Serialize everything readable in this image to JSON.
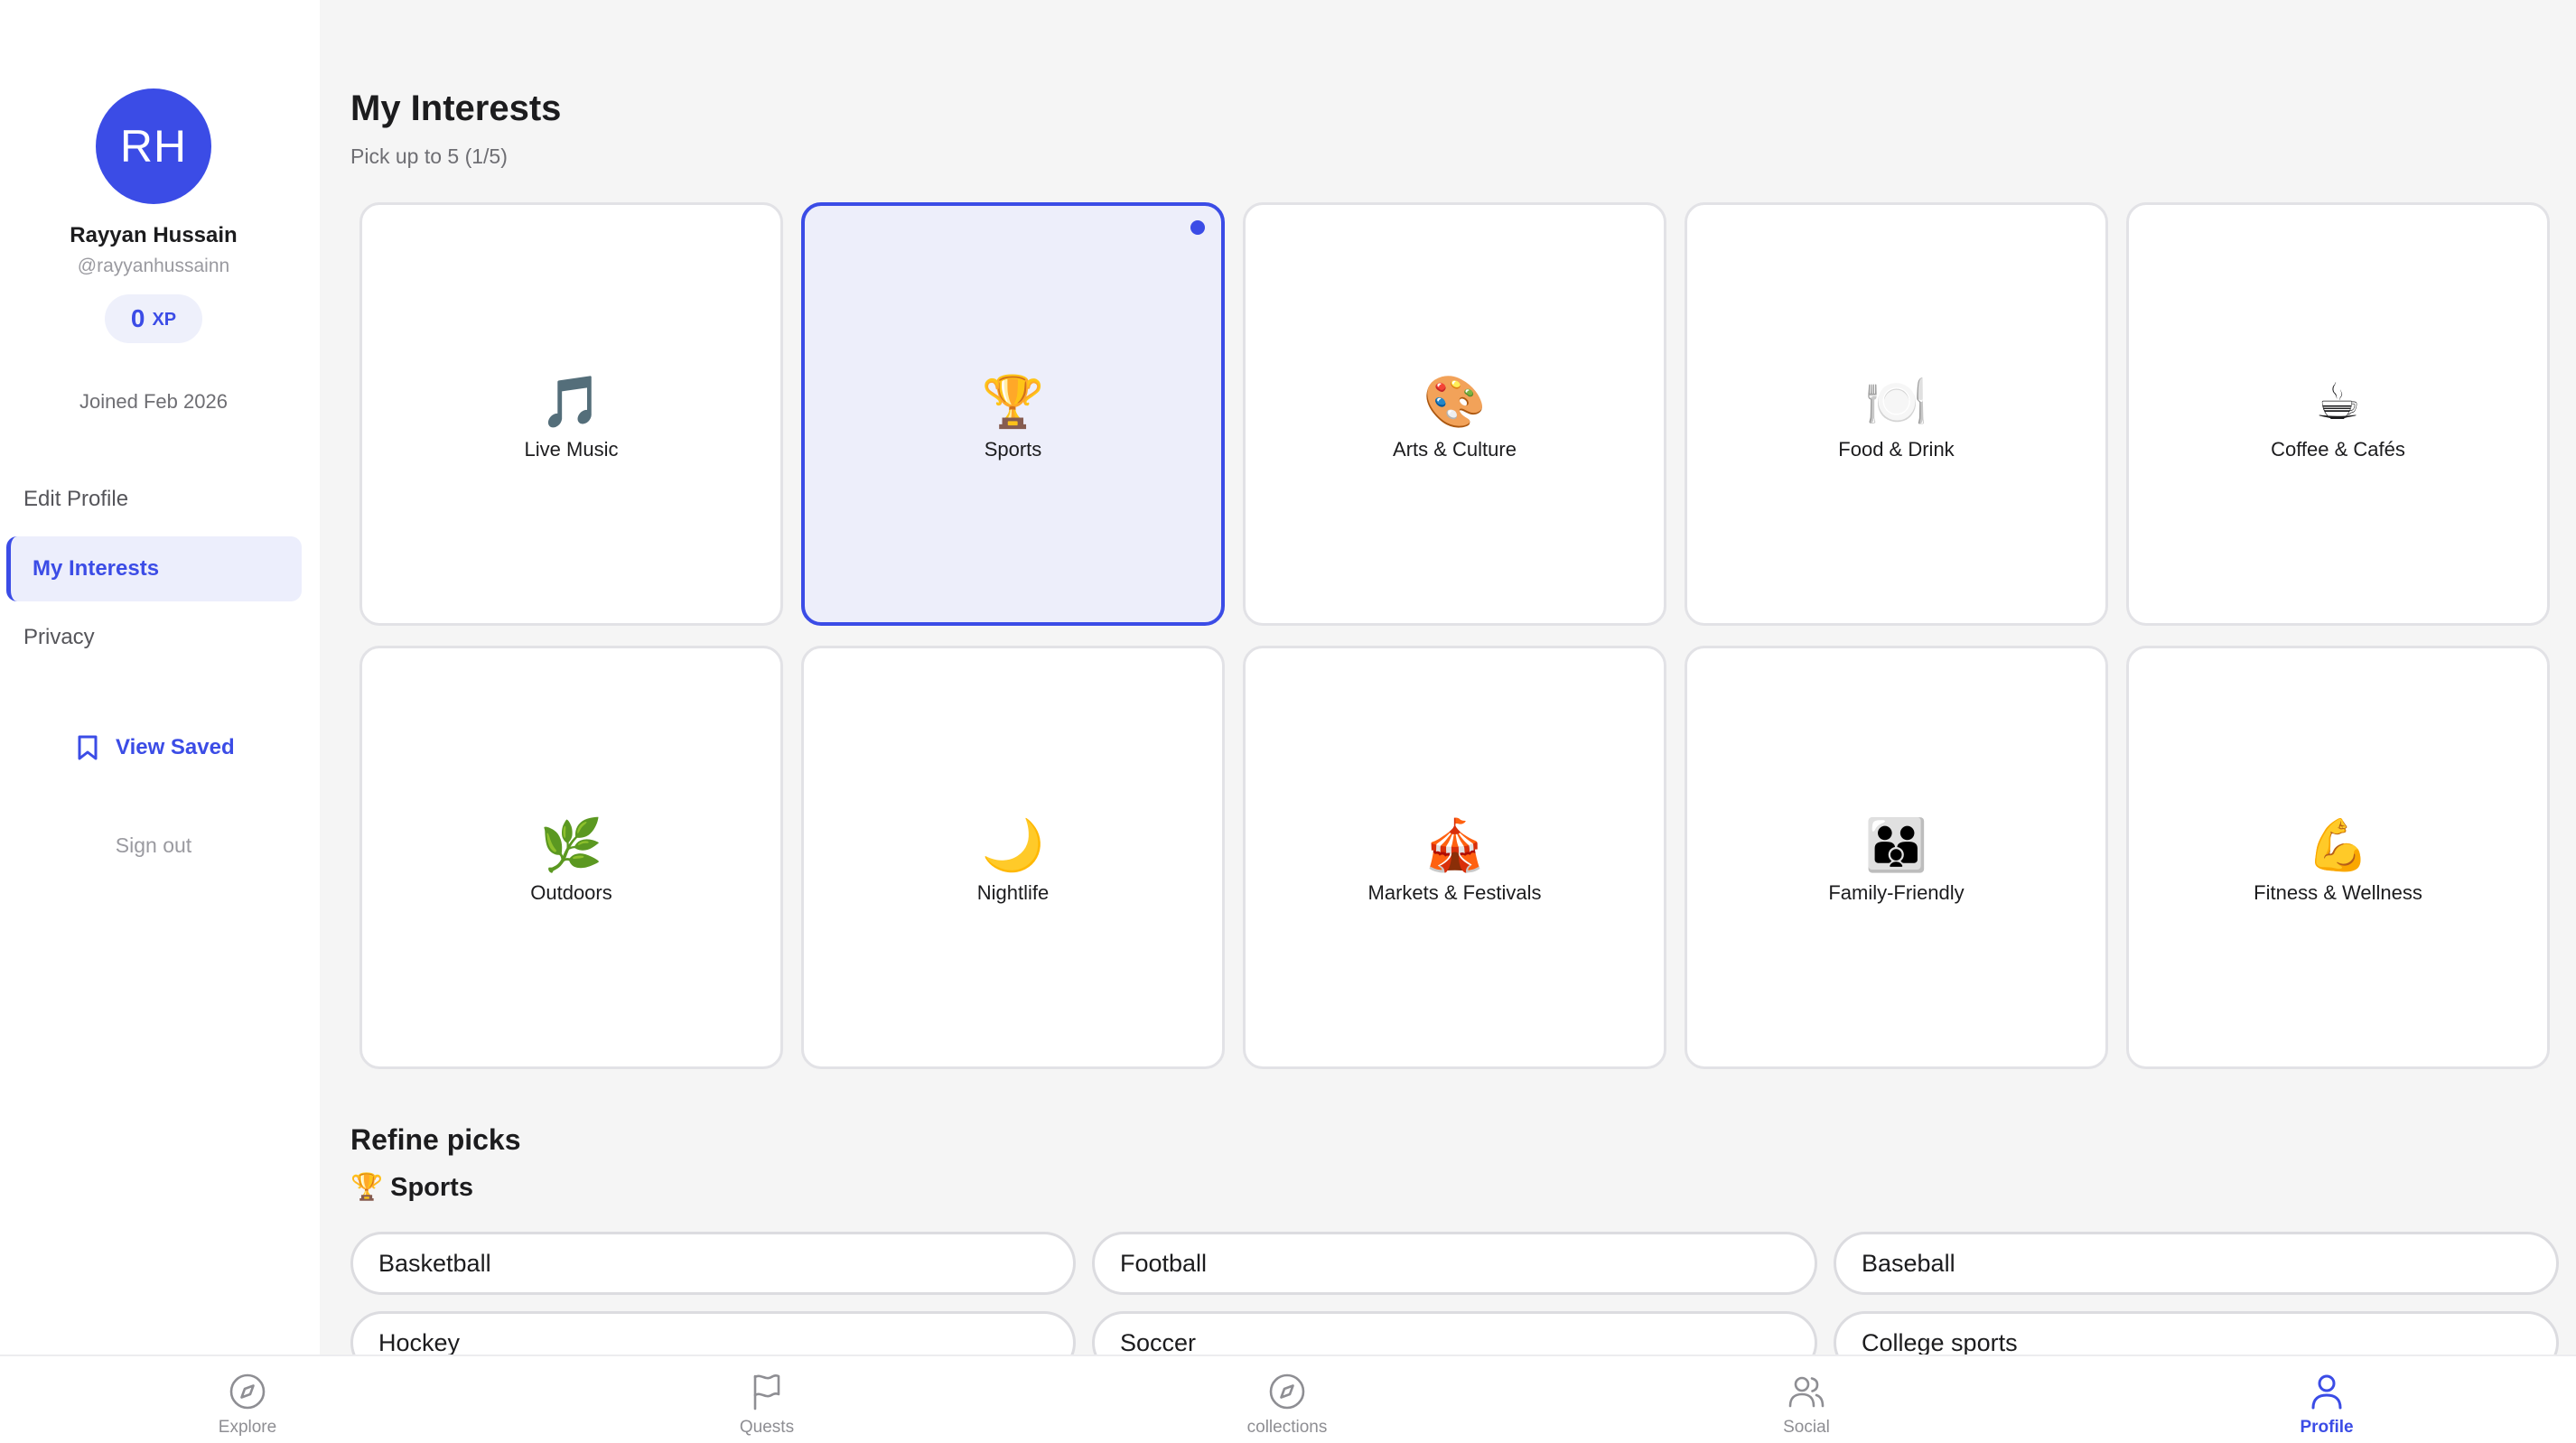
{
  "user": {
    "initials": "RH",
    "name": "Rayyan Hussain",
    "handle": "@rayyanhussainn",
    "xp_value": "0",
    "xp_label": "XP",
    "joined": "Joined Feb 2026"
  },
  "sidebar": {
    "items": [
      {
        "label": "Edit Profile",
        "active": false
      },
      {
        "label": "My Interests",
        "active": true
      },
      {
        "label": "Privacy",
        "active": false
      }
    ],
    "view_saved": "View Saved",
    "sign_out": "Sign out"
  },
  "main": {
    "title": "My Interests",
    "subtitle": "Pick up to 5 (1/5)",
    "interests": [
      {
        "emoji": "🎵",
        "icon": "musical-note-icon",
        "label": "Live Music",
        "selected": false
      },
      {
        "emoji": "🏆",
        "icon": "trophy-icon",
        "label": "Sports",
        "selected": true
      },
      {
        "emoji": "🎨",
        "icon": "palette-icon",
        "label": "Arts & Culture",
        "selected": false
      },
      {
        "emoji": "🍽️",
        "icon": "plate-icon",
        "label": "Food & Drink",
        "selected": false
      },
      {
        "emoji": "☕",
        "icon": "coffee-icon",
        "label": "Coffee & Cafés",
        "selected": false
      },
      {
        "emoji": "🌿",
        "icon": "herb-icon",
        "label": "Outdoors",
        "selected": false
      },
      {
        "emoji": "🌙",
        "icon": "moon-icon",
        "label": "Nightlife",
        "selected": false
      },
      {
        "emoji": "🎪",
        "icon": "circus-tent-icon",
        "label": "Markets & Festivals",
        "selected": false
      },
      {
        "emoji": "👪",
        "icon": "family-icon",
        "label": "Family-Friendly",
        "selected": false
      },
      {
        "emoji": "💪",
        "icon": "flexed-biceps-icon",
        "label": "Fitness & Wellness",
        "selected": false
      }
    ],
    "refine": {
      "title": "Refine picks",
      "group_emoji": "🏆",
      "group_label": "Sports",
      "chips": [
        "Basketball",
        "Football",
        "Baseball",
        "Hockey",
        "Soccer",
        "College sports"
      ]
    }
  },
  "tabbar": {
    "tabs": [
      {
        "label": "Explore",
        "icon": "compass-icon",
        "active": false
      },
      {
        "label": "Quests",
        "icon": "flag-icon",
        "active": false
      },
      {
        "label": "collections",
        "icon": "compass-icon",
        "active": false
      },
      {
        "label": "Social",
        "icon": "users-icon",
        "active": false
      },
      {
        "label": "Profile",
        "icon": "user-icon",
        "active": true
      }
    ]
  },
  "colors": {
    "accent": "#3b4ce6",
    "selected_bg": "#edeefa",
    "page_bg": "#f5f5f5"
  }
}
